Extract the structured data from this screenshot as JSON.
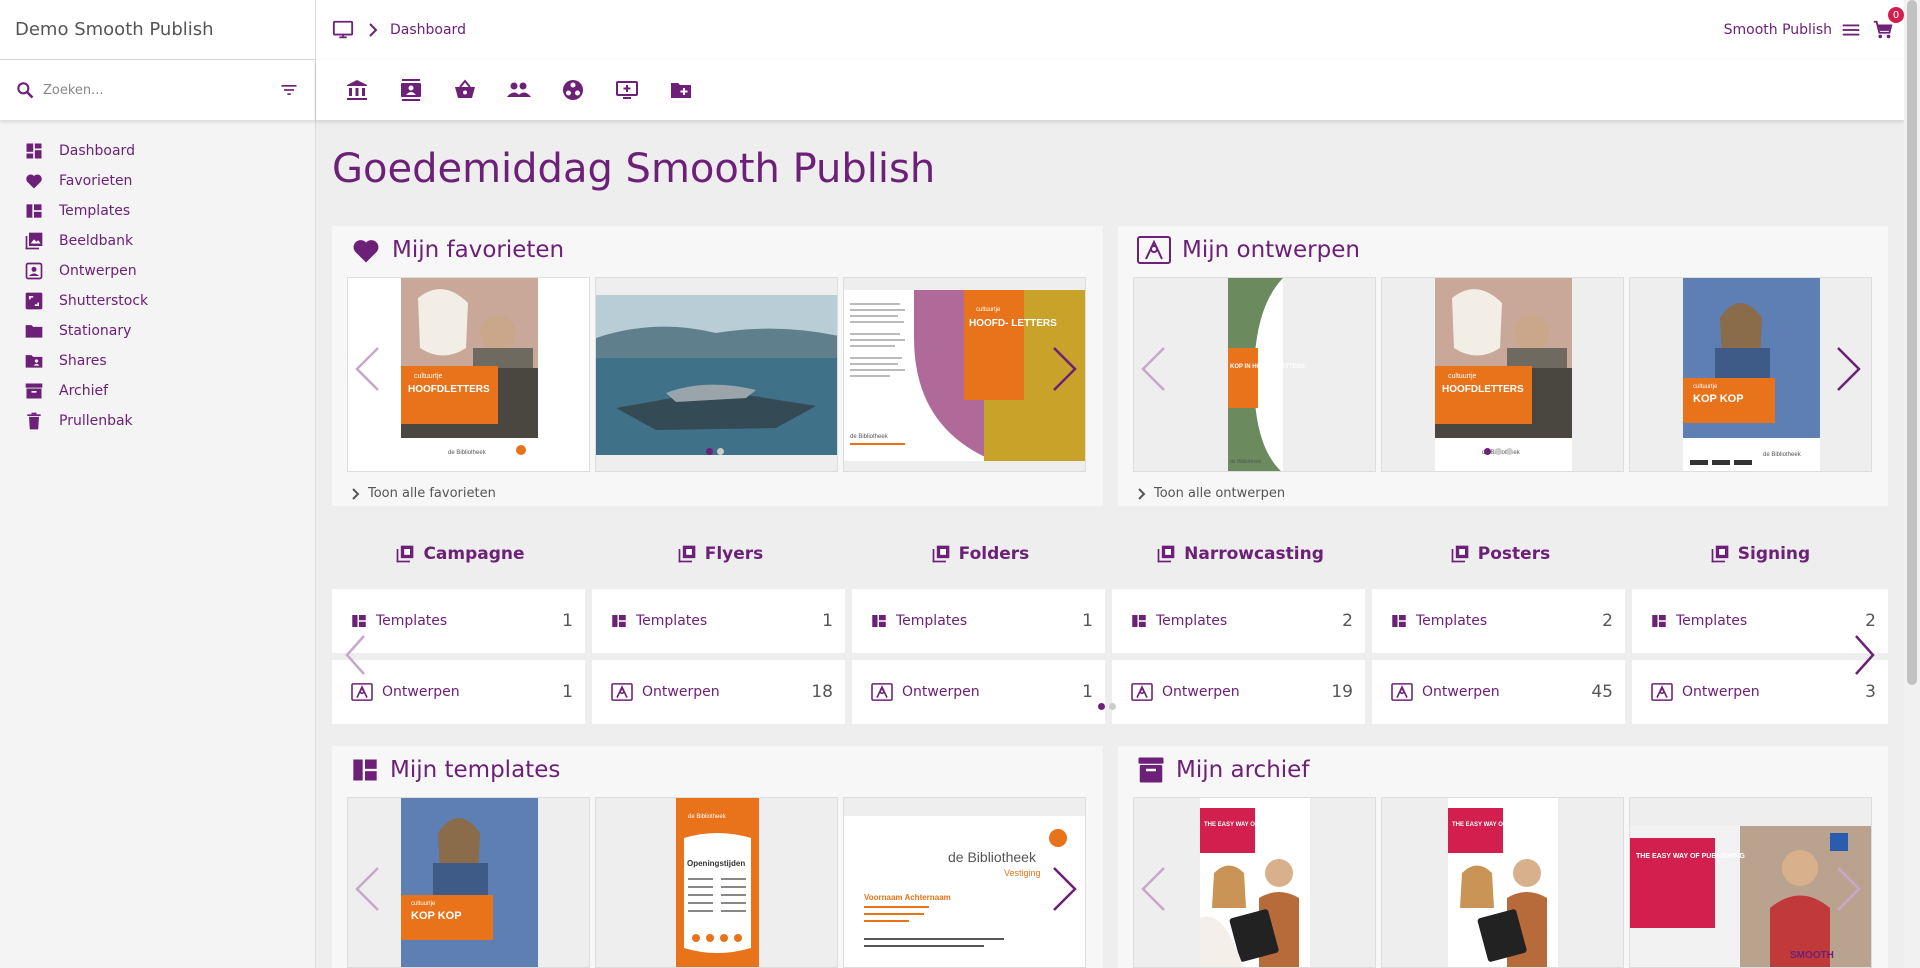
{
  "app": {
    "title": "Demo Smooth Publish"
  },
  "search": {
    "placeholder": "Zoeken..."
  },
  "sidebar": {
    "items": [
      {
        "label": "Dashboard",
        "icon": "dashboard-icon"
      },
      {
        "label": "Favorieten",
        "icon": "heart-icon"
      },
      {
        "label": "Templates",
        "icon": "templates-icon"
      },
      {
        "label": "Beeldbank",
        "icon": "image-library-icon"
      },
      {
        "label": "Ontwerpen",
        "icon": "design-icon"
      },
      {
        "label": "Shutterstock",
        "icon": "shutterstock-icon"
      },
      {
        "label": "Stationary",
        "icon": "folder-icon"
      },
      {
        "label": "Shares",
        "icon": "shared-folder-icon"
      },
      {
        "label": "Archief",
        "icon": "archive-icon"
      },
      {
        "label": "Prullenbak",
        "icon": "trash-icon"
      }
    ]
  },
  "header": {
    "breadcrumb": "Dashboard",
    "user": "Smooth Publish",
    "cart_count": "0"
  },
  "toolbar": {
    "icons": [
      "bank-icon",
      "contact-card-icon",
      "basket-icon",
      "people-icon",
      "hub-icon",
      "add-screen-icon",
      "new-folder-icon"
    ]
  },
  "main": {
    "greeting": "Goedemiddag Smooth Publish",
    "favorites": {
      "title": "Mijn favorieten",
      "show_all": "Toon alle favorieten",
      "cards": [
        {
          "label": "HOOFDLETTERS",
          "kicker": "cultuurtje",
          "brand": "de Bibliotheek"
        },
        {
          "label": ""
        },
        {
          "label": "HOOFD- LETTERS",
          "kicker": "cultuurtje",
          "brand": "de Bibliotheek"
        }
      ]
    },
    "designs": {
      "title": "Mijn ontwerpen",
      "show_all": "Toon alle ontwerpen",
      "cards": [
        {
          "label": "KOP IN HOOFD- LETTERS",
          "brand": "de Bibliotheek"
        },
        {
          "label": "HOOFDLETTERS",
          "kicker": "cultuurtje",
          "brand": "de Bibliotheek"
        },
        {
          "label": "KOP KOP",
          "kicker": "cultuurtje",
          "brand": "de Bibliotheek"
        }
      ]
    },
    "categories": [
      {
        "name": "Campagne",
        "templates_label": "Templates",
        "templates": "1",
        "designs_label": "Ontwerpen",
        "designs": "1"
      },
      {
        "name": "Flyers",
        "templates_label": "Templates",
        "templates": "1",
        "designs_label": "Ontwerpen",
        "designs": "18"
      },
      {
        "name": "Folders",
        "templates_label": "Templates",
        "templates": "1",
        "designs_label": "Ontwerpen",
        "designs": "1"
      },
      {
        "name": "Narrowcasting",
        "templates_label": "Templates",
        "templates": "2",
        "designs_label": "Ontwerpen",
        "designs": "19"
      },
      {
        "name": "Posters",
        "templates_label": "Templates",
        "templates": "2",
        "designs_label": "Ontwerpen",
        "designs": "45"
      },
      {
        "name": "Signing",
        "templates_label": "Templates",
        "templates": "2",
        "designs_label": "Ontwerpen",
        "designs": "3"
      }
    ],
    "templates": {
      "title": "Mijn templates",
      "cards": [
        {
          "label": "KOP KOP",
          "kicker": "cultuurtje"
        },
        {
          "label": "Openingstijden",
          "brand": "de Bibliotheek"
        },
        {
          "label": "de Bibliotheek",
          "sub": "Vestiging",
          "name": "Voornaam Achternaam"
        }
      ]
    },
    "archive": {
      "title": "Mijn archief",
      "cards": [
        {
          "label": "THE EASY WAY OF PUBLISHING"
        },
        {
          "label": "THE EASY WAY OF PUBLISHING"
        },
        {
          "label": "THE EASY WAY OF PUBLISHING",
          "brand": "SMOOTH"
        }
      ]
    }
  },
  "colors": {
    "accent": "#6d2077",
    "orange": "#e8731a",
    "red": "#d31f4d"
  }
}
